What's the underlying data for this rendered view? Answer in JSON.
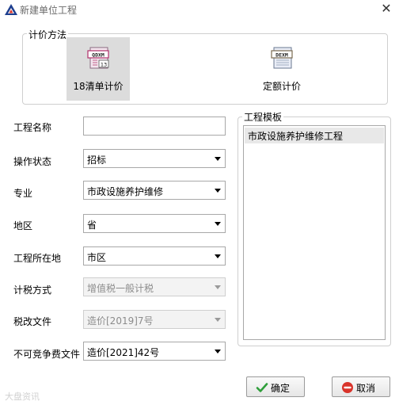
{
  "window": {
    "title": "新建单位工程",
    "close_glyph": "✕"
  },
  "pricing_method": {
    "legend": "计价方法",
    "options": [
      {
        "label": "18清单计价",
        "icon_text": "QDXM",
        "icon_sub": "13",
        "selected": true
      },
      {
        "label": "定额计价",
        "icon_text": "DEXM",
        "selected": false
      }
    ]
  },
  "form": {
    "project_name": {
      "label": "工程名称",
      "value": ""
    },
    "operation_status": {
      "label": "操作状态",
      "value": "招标"
    },
    "specialty": {
      "label": "专业",
      "value": "市政设施养护维修"
    },
    "region": {
      "label": "地区",
      "value": "省"
    },
    "location": {
      "label": "工程所在地",
      "value": "市区"
    },
    "tax_method": {
      "label": "计税方式",
      "value": "增值税一般计税",
      "disabled": true
    },
    "tax_reform_doc": {
      "label": "税改文件",
      "value": "造价[2019]7号",
      "disabled": true
    },
    "noncompetitive_doc": {
      "label": "不可竞争费文件",
      "value": "造价[2021]42号"
    }
  },
  "template": {
    "legend": "工程模板",
    "items": [
      "市政设施养护维修工程"
    ]
  },
  "buttons": {
    "ok": "确定",
    "cancel": "取消"
  },
  "watermark": "大盘资讯",
  "colors": {
    "ok_check": "#2e9e3a",
    "cancel_icon": "#d9342b",
    "selected_bg": "#dcdcdc"
  }
}
